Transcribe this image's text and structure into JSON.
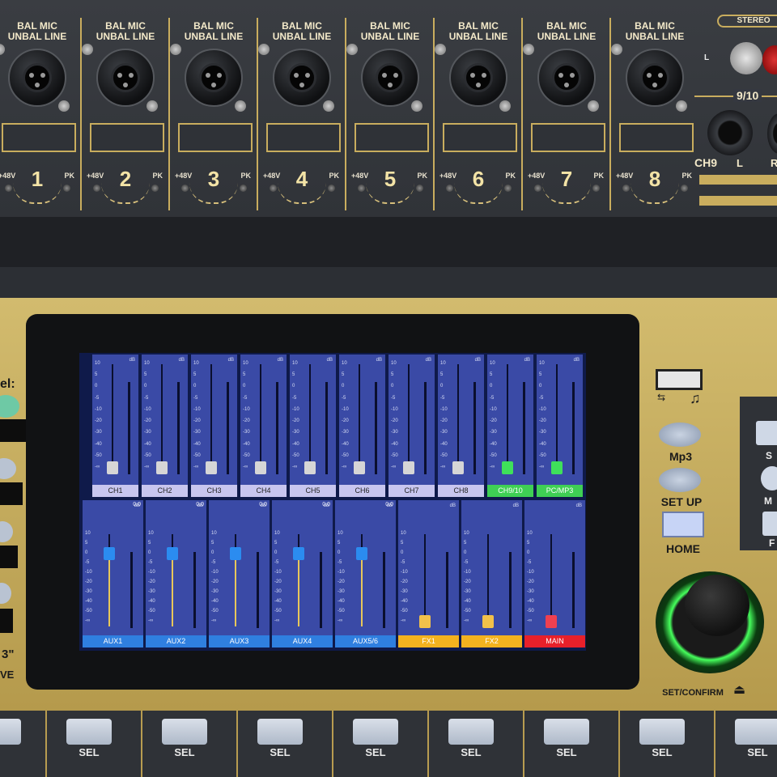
{
  "input_strips": [
    {
      "type_line1": "BAL MIC",
      "type_line2": "UNBAL LINE",
      "number": "1",
      "phantom": "+48V",
      "peak": "PK"
    },
    {
      "type_line1": "BAL MIC",
      "type_line2": "UNBAL LINE",
      "number": "2",
      "phantom": "+48V",
      "peak": "PK"
    },
    {
      "type_line1": "BAL MIC",
      "type_line2": "UNBAL LINE",
      "number": "3",
      "phantom": "+48V",
      "peak": "PK"
    },
    {
      "type_line1": "BAL MIC",
      "type_line2": "UNBAL LINE",
      "number": "4",
      "phantom": "+48V",
      "peak": "PK"
    },
    {
      "type_line1": "BAL MIC",
      "type_line2": "UNBAL LINE",
      "number": "5",
      "phantom": "+48V",
      "peak": "PK"
    },
    {
      "type_line1": "BAL MIC",
      "type_line2": "UNBAL LINE",
      "number": "6",
      "phantom": "+48V",
      "peak": "PK"
    },
    {
      "type_line1": "BAL MIC",
      "type_line2": "UNBAL LINE",
      "number": "7",
      "phantom": "+48V",
      "peak": "PK"
    },
    {
      "type_line1": "BAL MIC",
      "type_line2": "UNBAL LINE",
      "number": "8",
      "phantom": "+48V",
      "peak": "PK"
    }
  ],
  "stereo_section": {
    "title": "STEREO",
    "pair": "9/10",
    "ch9": "CH9",
    "left": "L",
    "right": "R"
  },
  "left_partial": {
    "label_fragment": "el:",
    "bottom_fragment_1": "3\"",
    "bottom_fragment_2": "VE"
  },
  "screen": {
    "db_unit": "dB",
    "scale_ticks": [
      "10",
      "5",
      "0",
      "-5",
      "-10",
      "-20",
      "-30",
      "-40",
      "-50",
      "-∞"
    ],
    "top_row": [
      {
        "label": "CH1",
        "fader_level": "-∞",
        "label_color": "#c8c6ef",
        "knob_color": "#d6d6d6"
      },
      {
        "label": "CH2",
        "fader_level": "-∞",
        "label_color": "#c8c6ef",
        "knob_color": "#d6d6d6"
      },
      {
        "label": "CH3",
        "fader_level": "-∞",
        "label_color": "#c8c6ef",
        "knob_color": "#d6d6d6"
      },
      {
        "label": "CH4",
        "fader_level": "-∞",
        "label_color": "#c8c6ef",
        "knob_color": "#d6d6d6"
      },
      {
        "label": "CH5",
        "fader_level": "-∞",
        "label_color": "#c8c6ef",
        "knob_color": "#d6d6d6"
      },
      {
        "label": "CH6",
        "fader_level": "-∞",
        "label_color": "#c8c6ef",
        "knob_color": "#d6d6d6"
      },
      {
        "label": "CH7",
        "fader_level": "-∞",
        "label_color": "#c8c6ef",
        "knob_color": "#d6d6d6"
      },
      {
        "label": "CH8",
        "fader_level": "-∞",
        "label_color": "#c8c6ef",
        "knob_color": "#d6d6d6"
      },
      {
        "label": "CH9/10",
        "fader_level": "-∞",
        "label_color": "#3fcf54",
        "knob_color": "#3fe05a"
      },
      {
        "label": "PC/MP3",
        "fader_level": "-∞",
        "label_color": "#3fcf54",
        "knob_color": "#3fe05a"
      }
    ],
    "bottom_row": [
      {
        "label": "AUX1",
        "value": "0.0",
        "fader_level": "0",
        "label_color": "#2f7fe0",
        "knob_color": "#2b8cf0"
      },
      {
        "label": "AUX2",
        "value": "0.0",
        "fader_level": "0",
        "label_color": "#2f7fe0",
        "knob_color": "#2b8cf0"
      },
      {
        "label": "AUX3",
        "value": "0.0",
        "fader_level": "0",
        "label_color": "#2f7fe0",
        "knob_color": "#2b8cf0"
      },
      {
        "label": "AUX4",
        "value": "0.0",
        "fader_level": "0",
        "label_color": "#2f7fe0",
        "knob_color": "#2b8cf0"
      },
      {
        "label": "AUX5/6",
        "value": "0.0",
        "fader_level": "0",
        "label_color": "#2f7fe0",
        "knob_color": "#2b8cf0"
      },
      {
        "label": "FX1",
        "value": "",
        "fader_level": "-∞",
        "label_color": "#f3b21f",
        "knob_color": "#f2c14a"
      },
      {
        "label": "FX2",
        "value": "",
        "fader_level": "-∞",
        "label_color": "#f3b21f",
        "knob_color": "#f2c14a"
      },
      {
        "label": "MAIN",
        "value": "",
        "fader_level": "-∞",
        "label_color": "#e8202a",
        "knob_color": "#f04050"
      }
    ]
  },
  "controls": {
    "mp3": "Mp3",
    "setup": "SET UP",
    "home": "HOME",
    "set_confirm": "SET/CONFIRM",
    "usb_icon": "usb-icon",
    "music_icon": "♫",
    "right_partial": [
      "S",
      "M",
      "F"
    ]
  },
  "bottom_buttons": [
    "SEL",
    "SEL",
    "SEL",
    "SEL",
    "SEL",
    "SEL",
    "SEL",
    "SEL"
  ]
}
